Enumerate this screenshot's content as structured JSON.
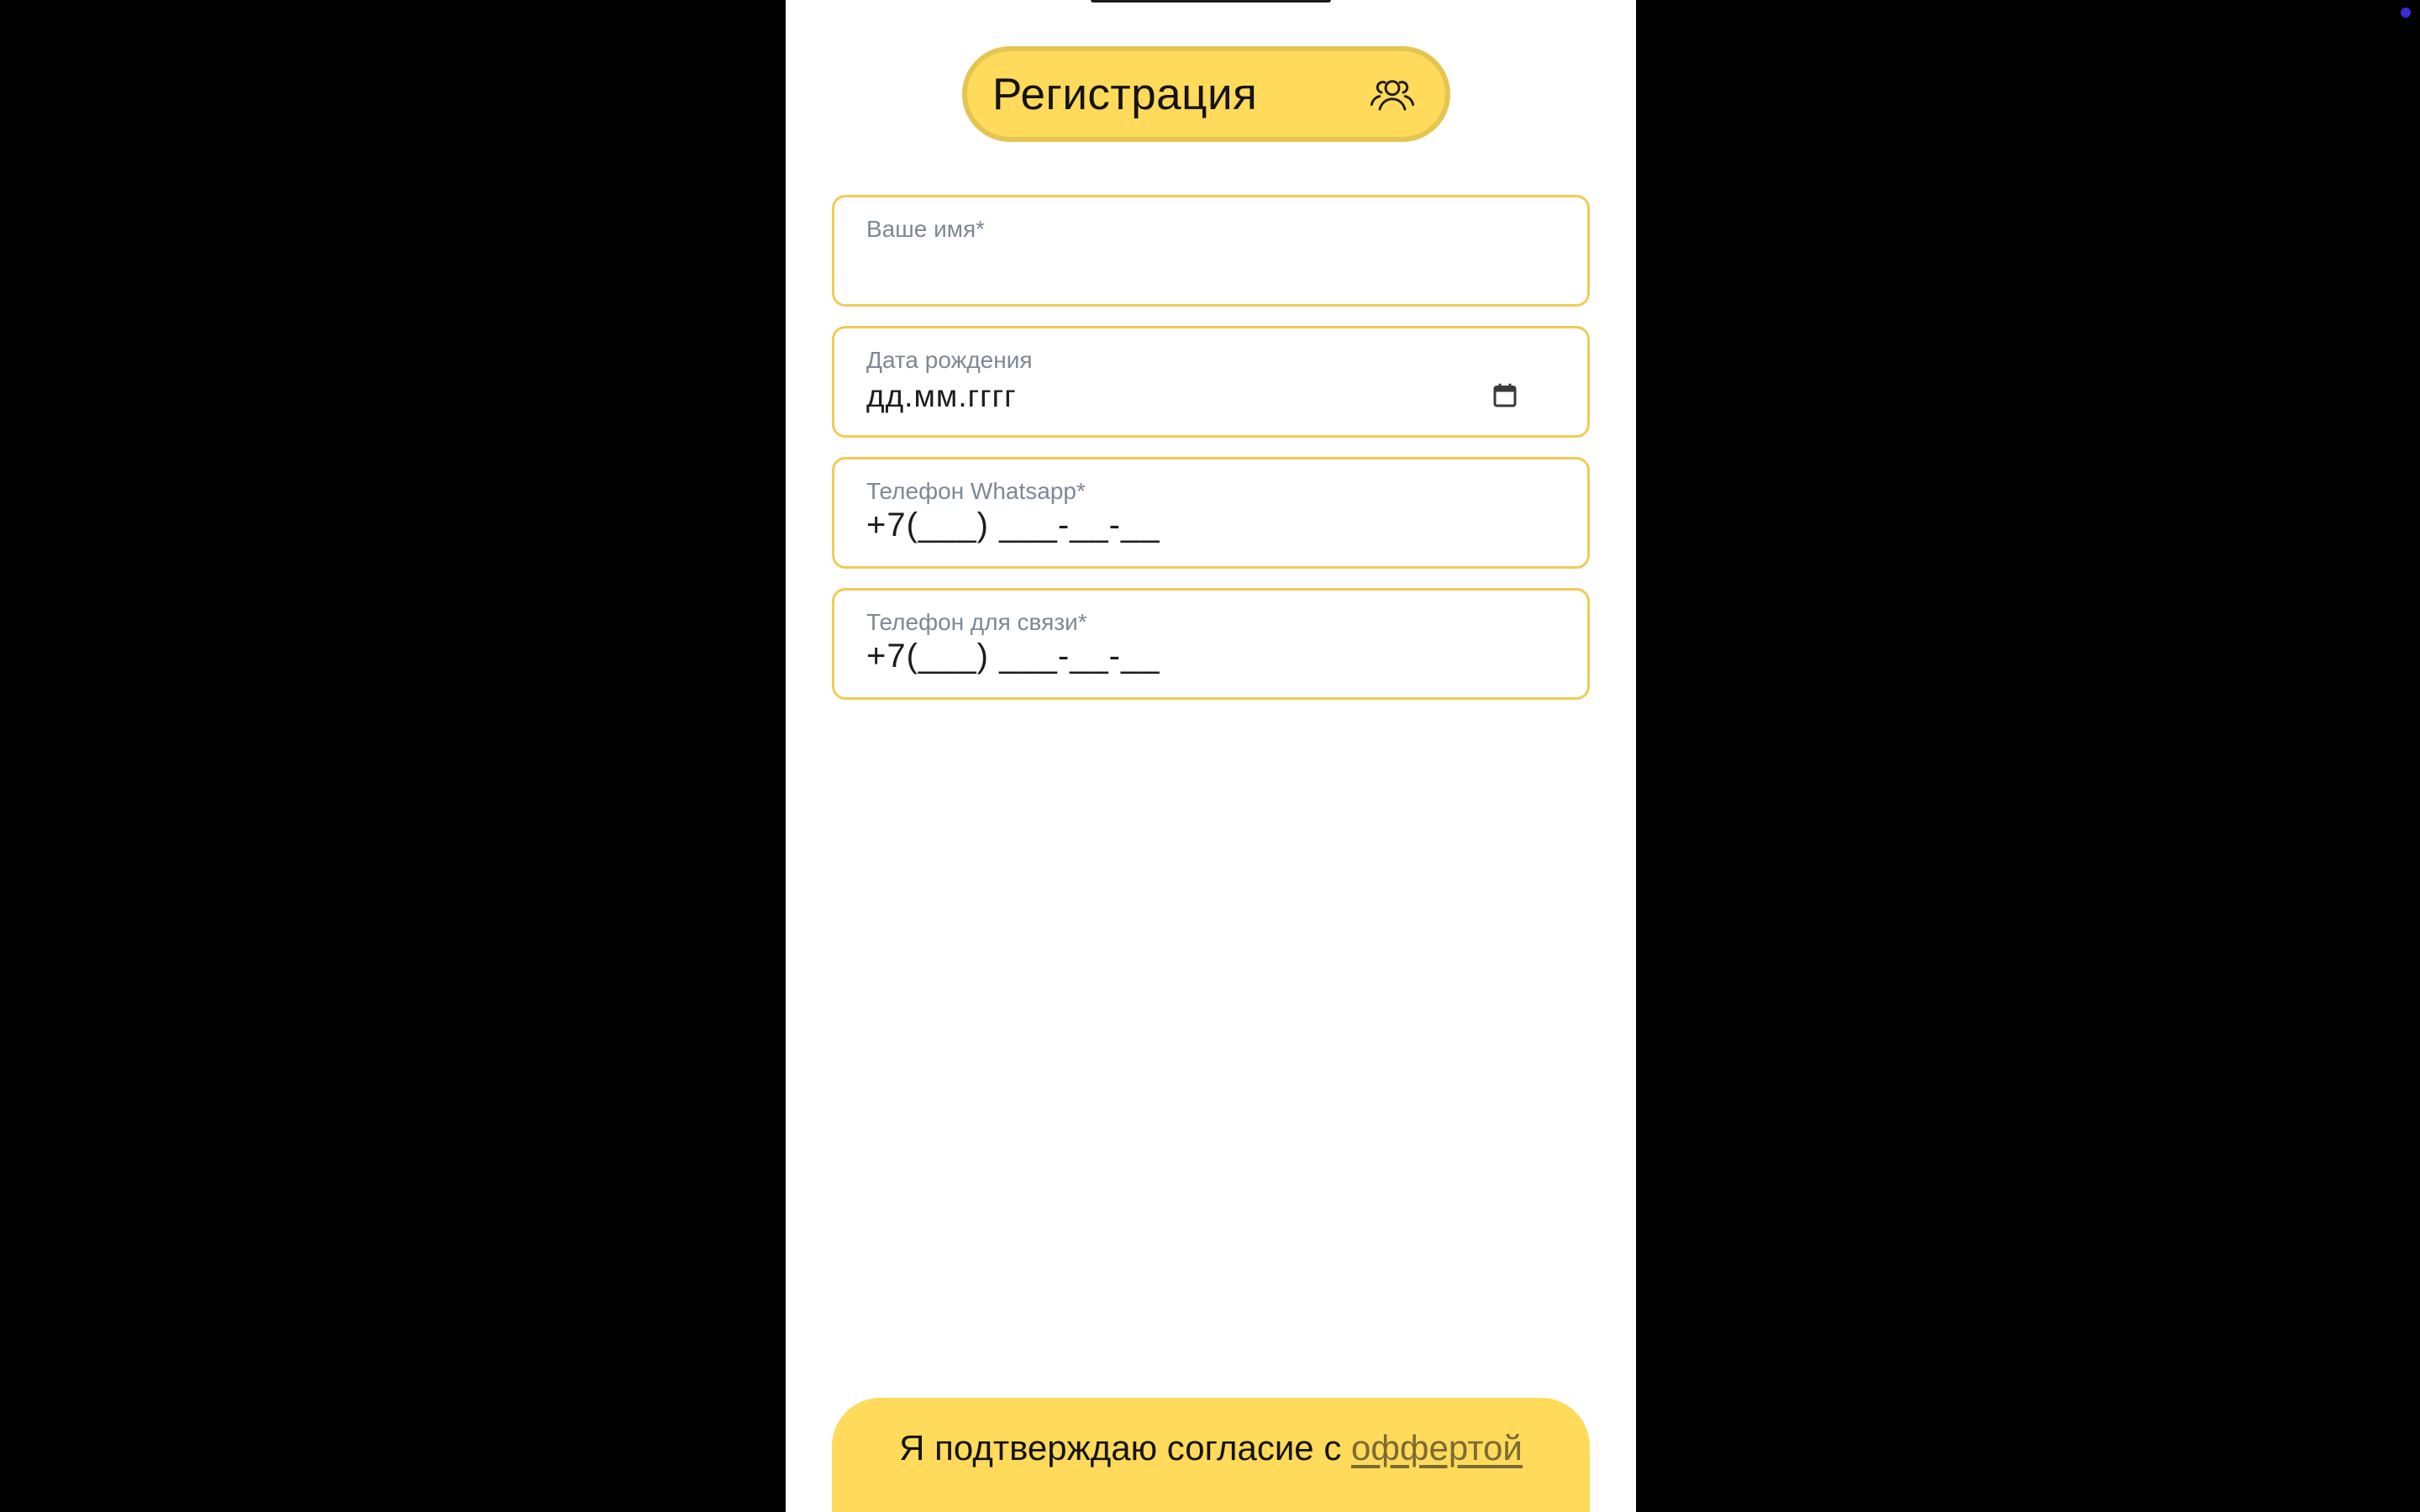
{
  "header": {
    "title": "Регистрация",
    "icon": "users-icon"
  },
  "form": {
    "name_field": {
      "label": "Ваше имя*",
      "value": ""
    },
    "birthdate_field": {
      "label": "Дата рождения",
      "placeholder": "дд.мм.гггг",
      "icon": "calendar-icon"
    },
    "whatsapp_field": {
      "label": "Телефон Whatsapp*",
      "mask": "+7(___) ___-__-__"
    },
    "contact_phone_field": {
      "label": "Телефон для связи*",
      "mask": "+7(___) ___-__-__"
    }
  },
  "footer": {
    "consent_text": "Я подтверждаю согласие с ",
    "offer_link": "оффертой"
  },
  "colors": {
    "accent_yellow": "#ffda5b",
    "field_border": "#f0cb55",
    "label_gray": "#7d8896",
    "link_brown": "#7a6a35",
    "background": "#000000"
  }
}
